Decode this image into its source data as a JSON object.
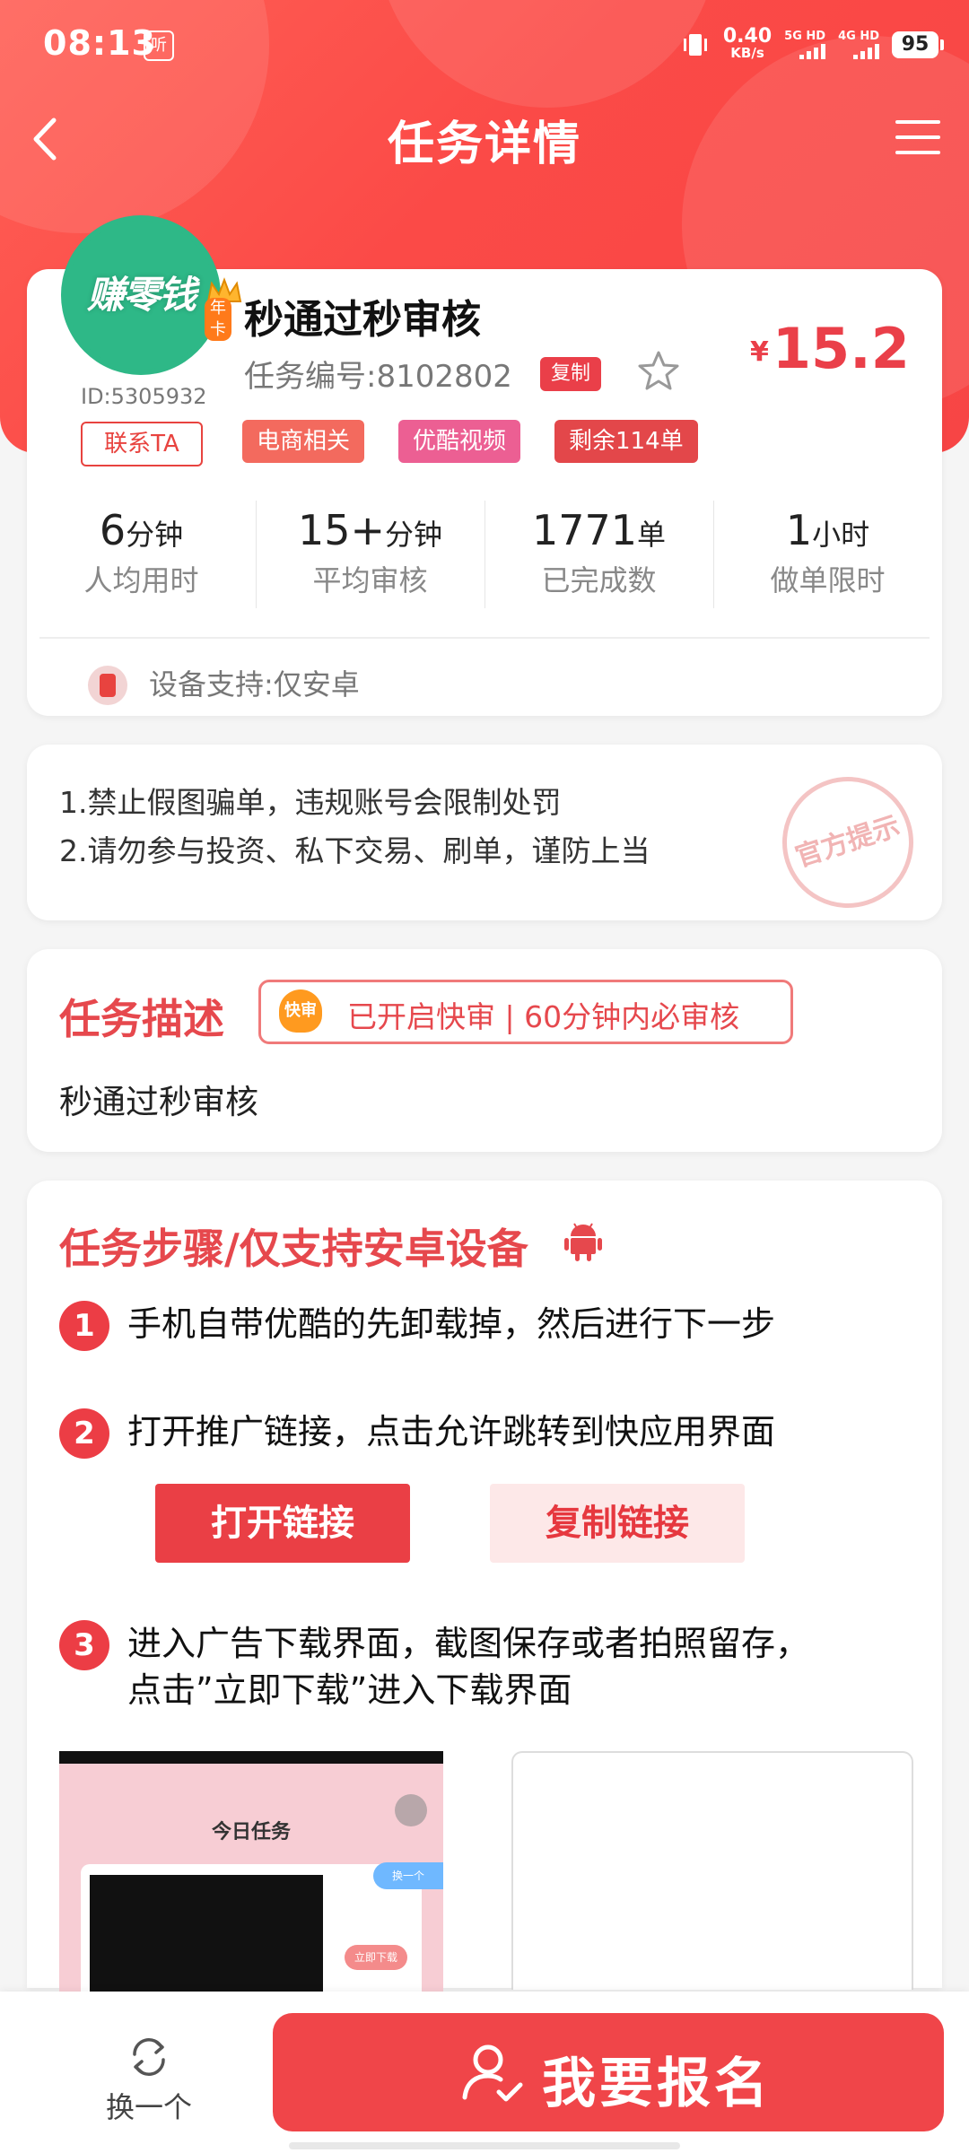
{
  "status_bar": {
    "time": "08:13",
    "listen_badge": "听",
    "net_speed": "0.40",
    "net_unit": "KB/s",
    "sim1": "5G HD",
    "sim2": "4G HD",
    "battery": "95"
  },
  "nav": {
    "title": "任务详情"
  },
  "task": {
    "avatar_text": "赚零钱",
    "vip_tag": "年卡",
    "user_id": "ID:5305932",
    "contact_label": "联系TA",
    "title": "秒通过秒审核",
    "number": "任务编号:8102802",
    "copy_label": "复制",
    "price_symbol": "¥",
    "price": "15.2",
    "tags": [
      "电商相关",
      "优酷视频",
      "剩余114单"
    ],
    "stats": [
      {
        "value": "6",
        "unit": "分钟",
        "label": "人均用时"
      },
      {
        "value": "15+",
        "unit": "分钟",
        "label": "平均审核"
      },
      {
        "value": "1771",
        "unit": "单",
        "label": "已完成数"
      },
      {
        "value": "1",
        "unit": "小时",
        "label": "做单限时"
      }
    ],
    "device_support": "设备支持:仅安卓"
  },
  "notice": {
    "lines": [
      "1.禁止假图骗单，违规账号会限制处罚",
      "2.请勿参与投资、私下交易、刷单，谨防上当"
    ],
    "stamp": "官方提示"
  },
  "description": {
    "title": "任务描述",
    "fast_icon": "快审",
    "fast_text": "已开启快审 | 60分钟内必审核",
    "text": "秒通过秒审核"
  },
  "steps": {
    "title": "任务步骤/仅支持安卓设备",
    "items": [
      {
        "num": "1",
        "text": "手机自带优酷的先卸载掉，然后进行下一步"
      },
      {
        "num": "2",
        "text": "打开推广链接，点击允许跳转到快应用界面"
      },
      {
        "num": "3",
        "text": "进入广告下载界面，截图保存或者拍照留存，",
        "text2": "点击”立即下载”进入下载界面"
      }
    ],
    "open_link": "打开链接",
    "copy_link": "复制链接",
    "screenshot": {
      "title": "今日任务",
      "btn_change": "换一个",
      "btn_download": "立即下载"
    }
  },
  "bottom": {
    "switch_label": "换一个",
    "signup_label": "我要报名"
  },
  "colors": {
    "primary": "#ea3f45",
    "tag_ecommerce": "#f36a5e",
    "tag_youku": "#ec5f93",
    "tag_remaining": "#e3474a",
    "avatar_green": "#2eb887"
  }
}
